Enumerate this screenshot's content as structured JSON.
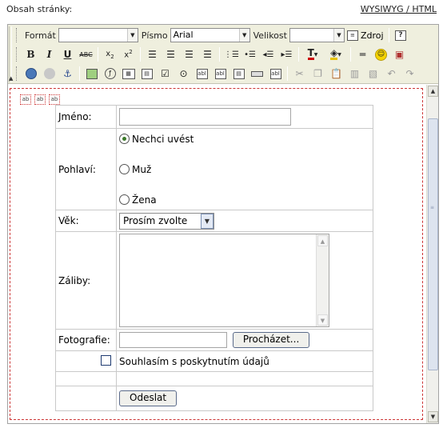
{
  "page": {
    "label": "Obsah stránky:",
    "mode_link": "WYSIWYG / HTML"
  },
  "toolbar": {
    "format_label": "Formát",
    "format_value": "",
    "font_label": "Písmo",
    "font_value": "Arial",
    "size_label": "Velikost",
    "size_value": "",
    "source_label": "Zdroj"
  },
  "form": {
    "name_label": "Jméno:",
    "name_value": "",
    "gender_label": "Pohlaví:",
    "gender_options": [
      "Nechci uvést",
      "Muž",
      "Žena"
    ],
    "gender_selected": "Nechci uvést",
    "age_label": "Věk:",
    "age_select_value": "Prosím zvolte",
    "hobbies_label": "Záliby:",
    "photo_label": "Fotografie:",
    "browse_label": "Procházet...",
    "consent_label": "Souhlasím s poskytnutím údajů",
    "consent_checked": false,
    "submit_label": "Odeslat"
  },
  "hidden_field_glyph": "ab"
}
